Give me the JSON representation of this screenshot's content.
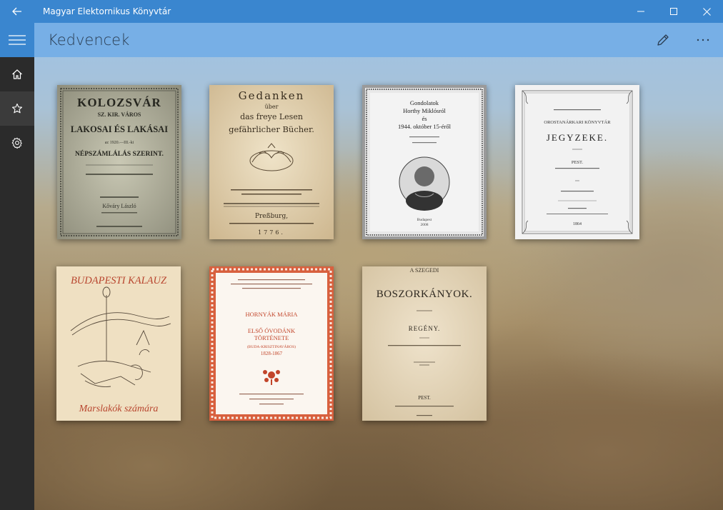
{
  "window": {
    "title": "Magyar Elektornikus Könyvtár"
  },
  "header": {
    "title": "Kedvencek"
  },
  "books": [
    {
      "line1": "KOLOZSVÁR",
      "line2": "SZ. KIR. VÁROS",
      "line3": "LAKOSAI ÉS LAKÁSAI",
      "line4": "az 1920.—III.-ki",
      "line5": "NÉPSZÁMLÁLÁS SZERINT.",
      "line6": "Kőváry László"
    },
    {
      "line1": "Gedanken",
      "line2": "über",
      "line3": "das freye Lesen",
      "line4": "gefährlicher Bücher.",
      "line5": "Preßburg,",
      "line6": "1776."
    },
    {
      "line1": "Gondolatok",
      "line2": "Horthy Miklósról",
      "line3": "és",
      "line4": "1944. október 15-éről",
      "line5": "Budapest",
      "line6": "2008"
    },
    {
      "line1": "OROSTANÁRKARI KÖNYVTÁR",
      "line2": "JEGYZEKE.",
      "line3": "PEST.",
      "line4": "1864"
    },
    {
      "line1": "BUDAPESTI KALAUZ",
      "line2": "Marslakók számára"
    },
    {
      "line1": "HORNYÁK MÁRIA",
      "line2": "ELSŐ ÓVODÁNK",
      "line3": "TÖRTÉNETE",
      "line4": "(BUDA-KRISZTINAVÁROS)",
      "line5": "1828-1867"
    },
    {
      "line1": "A SZEGEDI",
      "line2": "BOSZORKÁNYOK.",
      "line3": "REGÉNY.",
      "line4": "PEST."
    }
  ],
  "icons": {
    "back": "back-arrow-icon",
    "minimize": "minimize-icon",
    "maximize": "maximize-icon",
    "close": "close-icon",
    "menu": "hamburger-menu-icon",
    "home": "home-icon",
    "favorites": "star-icon",
    "settings": "gear-icon",
    "edit": "pencil-icon",
    "more": "more-icon"
  },
  "colors": {
    "accent": "#3a86cf",
    "header": "#77afe6",
    "rail": "#2b2b2b"
  }
}
